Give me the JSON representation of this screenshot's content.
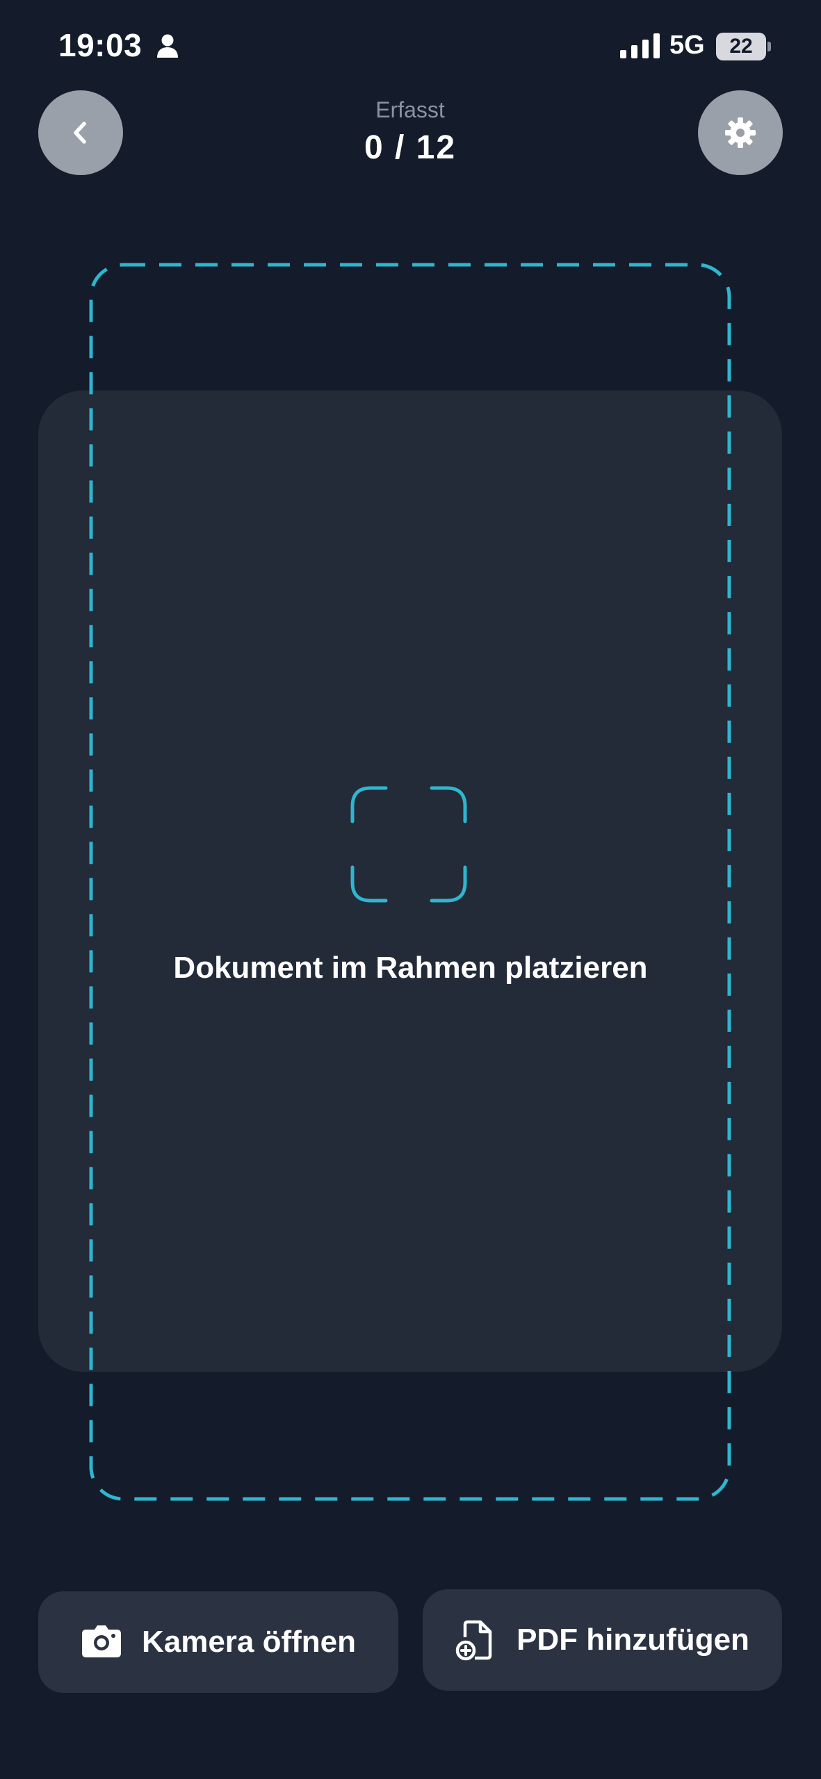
{
  "status_bar": {
    "time": "19:03",
    "network": "5G",
    "battery": "22",
    "icons": [
      "person-icon",
      "signal-icon",
      "battery-icon"
    ]
  },
  "header": {
    "label": "Erfasst",
    "count": "0 / 12",
    "back_icon": "chevron-left-icon",
    "settings_icon": "gear-icon"
  },
  "preview": {
    "hint": "Dokument im Rahmen platzieren",
    "focus_icon": "viewfinder-icon"
  },
  "actions": {
    "camera_label": "Kamera öffnen",
    "camera_icon": "camera-icon",
    "pdf_label": "PDF hinzufügen",
    "pdf_icon": "file-add-icon"
  },
  "colors": {
    "background": "#141b2a",
    "card": "#232a38",
    "button": "#2b3241",
    "accent": "#2fb6cf",
    "round_button": "#9aa0aa"
  }
}
